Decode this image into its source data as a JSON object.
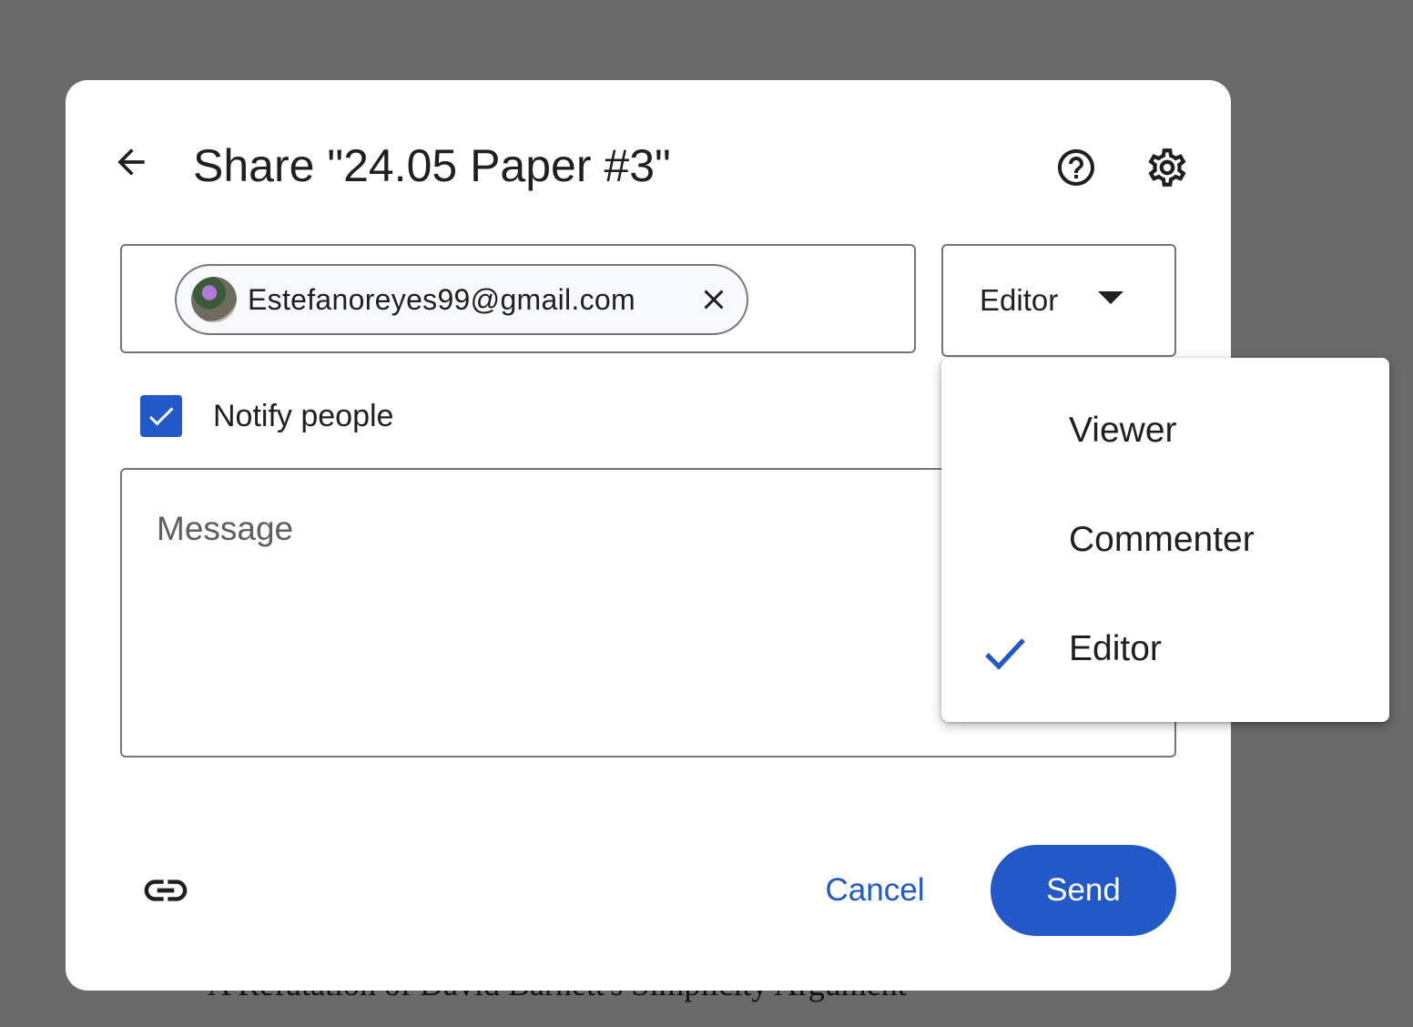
{
  "background": {
    "doc_text": "A Refutation of David Barnett's Simplicity Argument"
  },
  "dialog": {
    "title": "Share \"24.05 Paper #3\"",
    "icons": {
      "back": "arrow-back-icon",
      "help": "help-circle-icon",
      "settings": "gear-icon",
      "link": "link-icon"
    }
  },
  "people_input": {
    "chips": [
      {
        "email": "Estefanoreyes99@gmail.com",
        "remove_icon": "close-icon"
      }
    ]
  },
  "role_select": {
    "value": "Editor",
    "caret_icon": "caret-down-icon"
  },
  "notify": {
    "label": "Notify people",
    "checked": true
  },
  "message": {
    "placeholder": "Message"
  },
  "footer": {
    "cancel_label": "Cancel",
    "send_label": "Send"
  },
  "role_menu": {
    "items": [
      {
        "label": "Viewer",
        "selected": false
      },
      {
        "label": "Commenter",
        "selected": false
      },
      {
        "label": "Editor",
        "selected": true
      }
    ]
  },
  "colors": {
    "accent": "#2358c9",
    "overlay": "#6a6a6a",
    "border": "#747775"
  }
}
